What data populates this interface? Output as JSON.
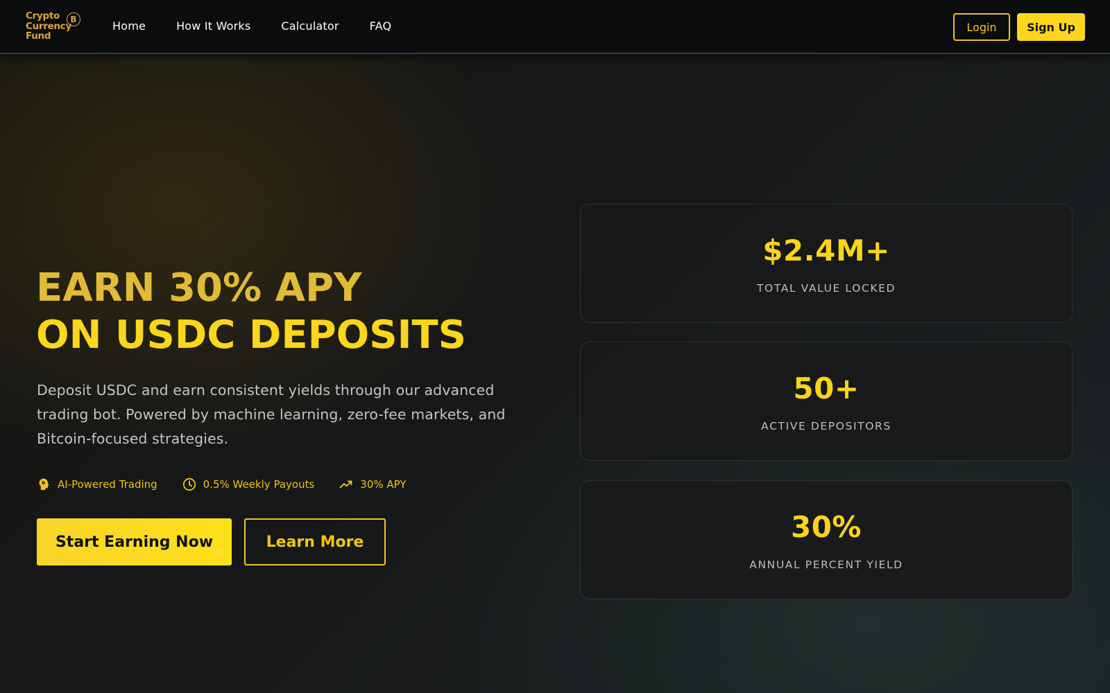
{
  "brand": {
    "logo_lines": [
      "Crypto",
      "Currency",
      "Fund"
    ],
    "logo_symbol": "B",
    "accent": "#f2c41a"
  },
  "nav": {
    "links": [
      "Home",
      "How It Works",
      "Calculator",
      "FAQ"
    ],
    "login_label": "Login",
    "signup_label": "Sign Up"
  },
  "hero": {
    "title_line1": "EARN 30% APY",
    "title_line2": "ON USDC DEPOSITS",
    "description": "Deposit USDC and earn consistent yields through our advanced trading bot. Powered by machine learning, zero-fee markets, and Bitcoin-focused strategies.",
    "features": [
      {
        "icon": "brain-icon",
        "label": "AI-Powered Trading"
      },
      {
        "icon": "clock-icon",
        "label": "0.5% Weekly Payouts"
      },
      {
        "icon": "trending-up-icon",
        "label": "30% APY"
      }
    ],
    "primary_cta": "Start Earning Now",
    "secondary_cta": "Learn More"
  },
  "stats": [
    {
      "value": "$2.4M+",
      "label": "TOTAL VALUE LOCKED"
    },
    {
      "value": "50+",
      "label": "ACTIVE DEPOSITORS"
    },
    {
      "value": "30%",
      "label": "ANNUAL PERCENT YIELD"
    }
  ]
}
